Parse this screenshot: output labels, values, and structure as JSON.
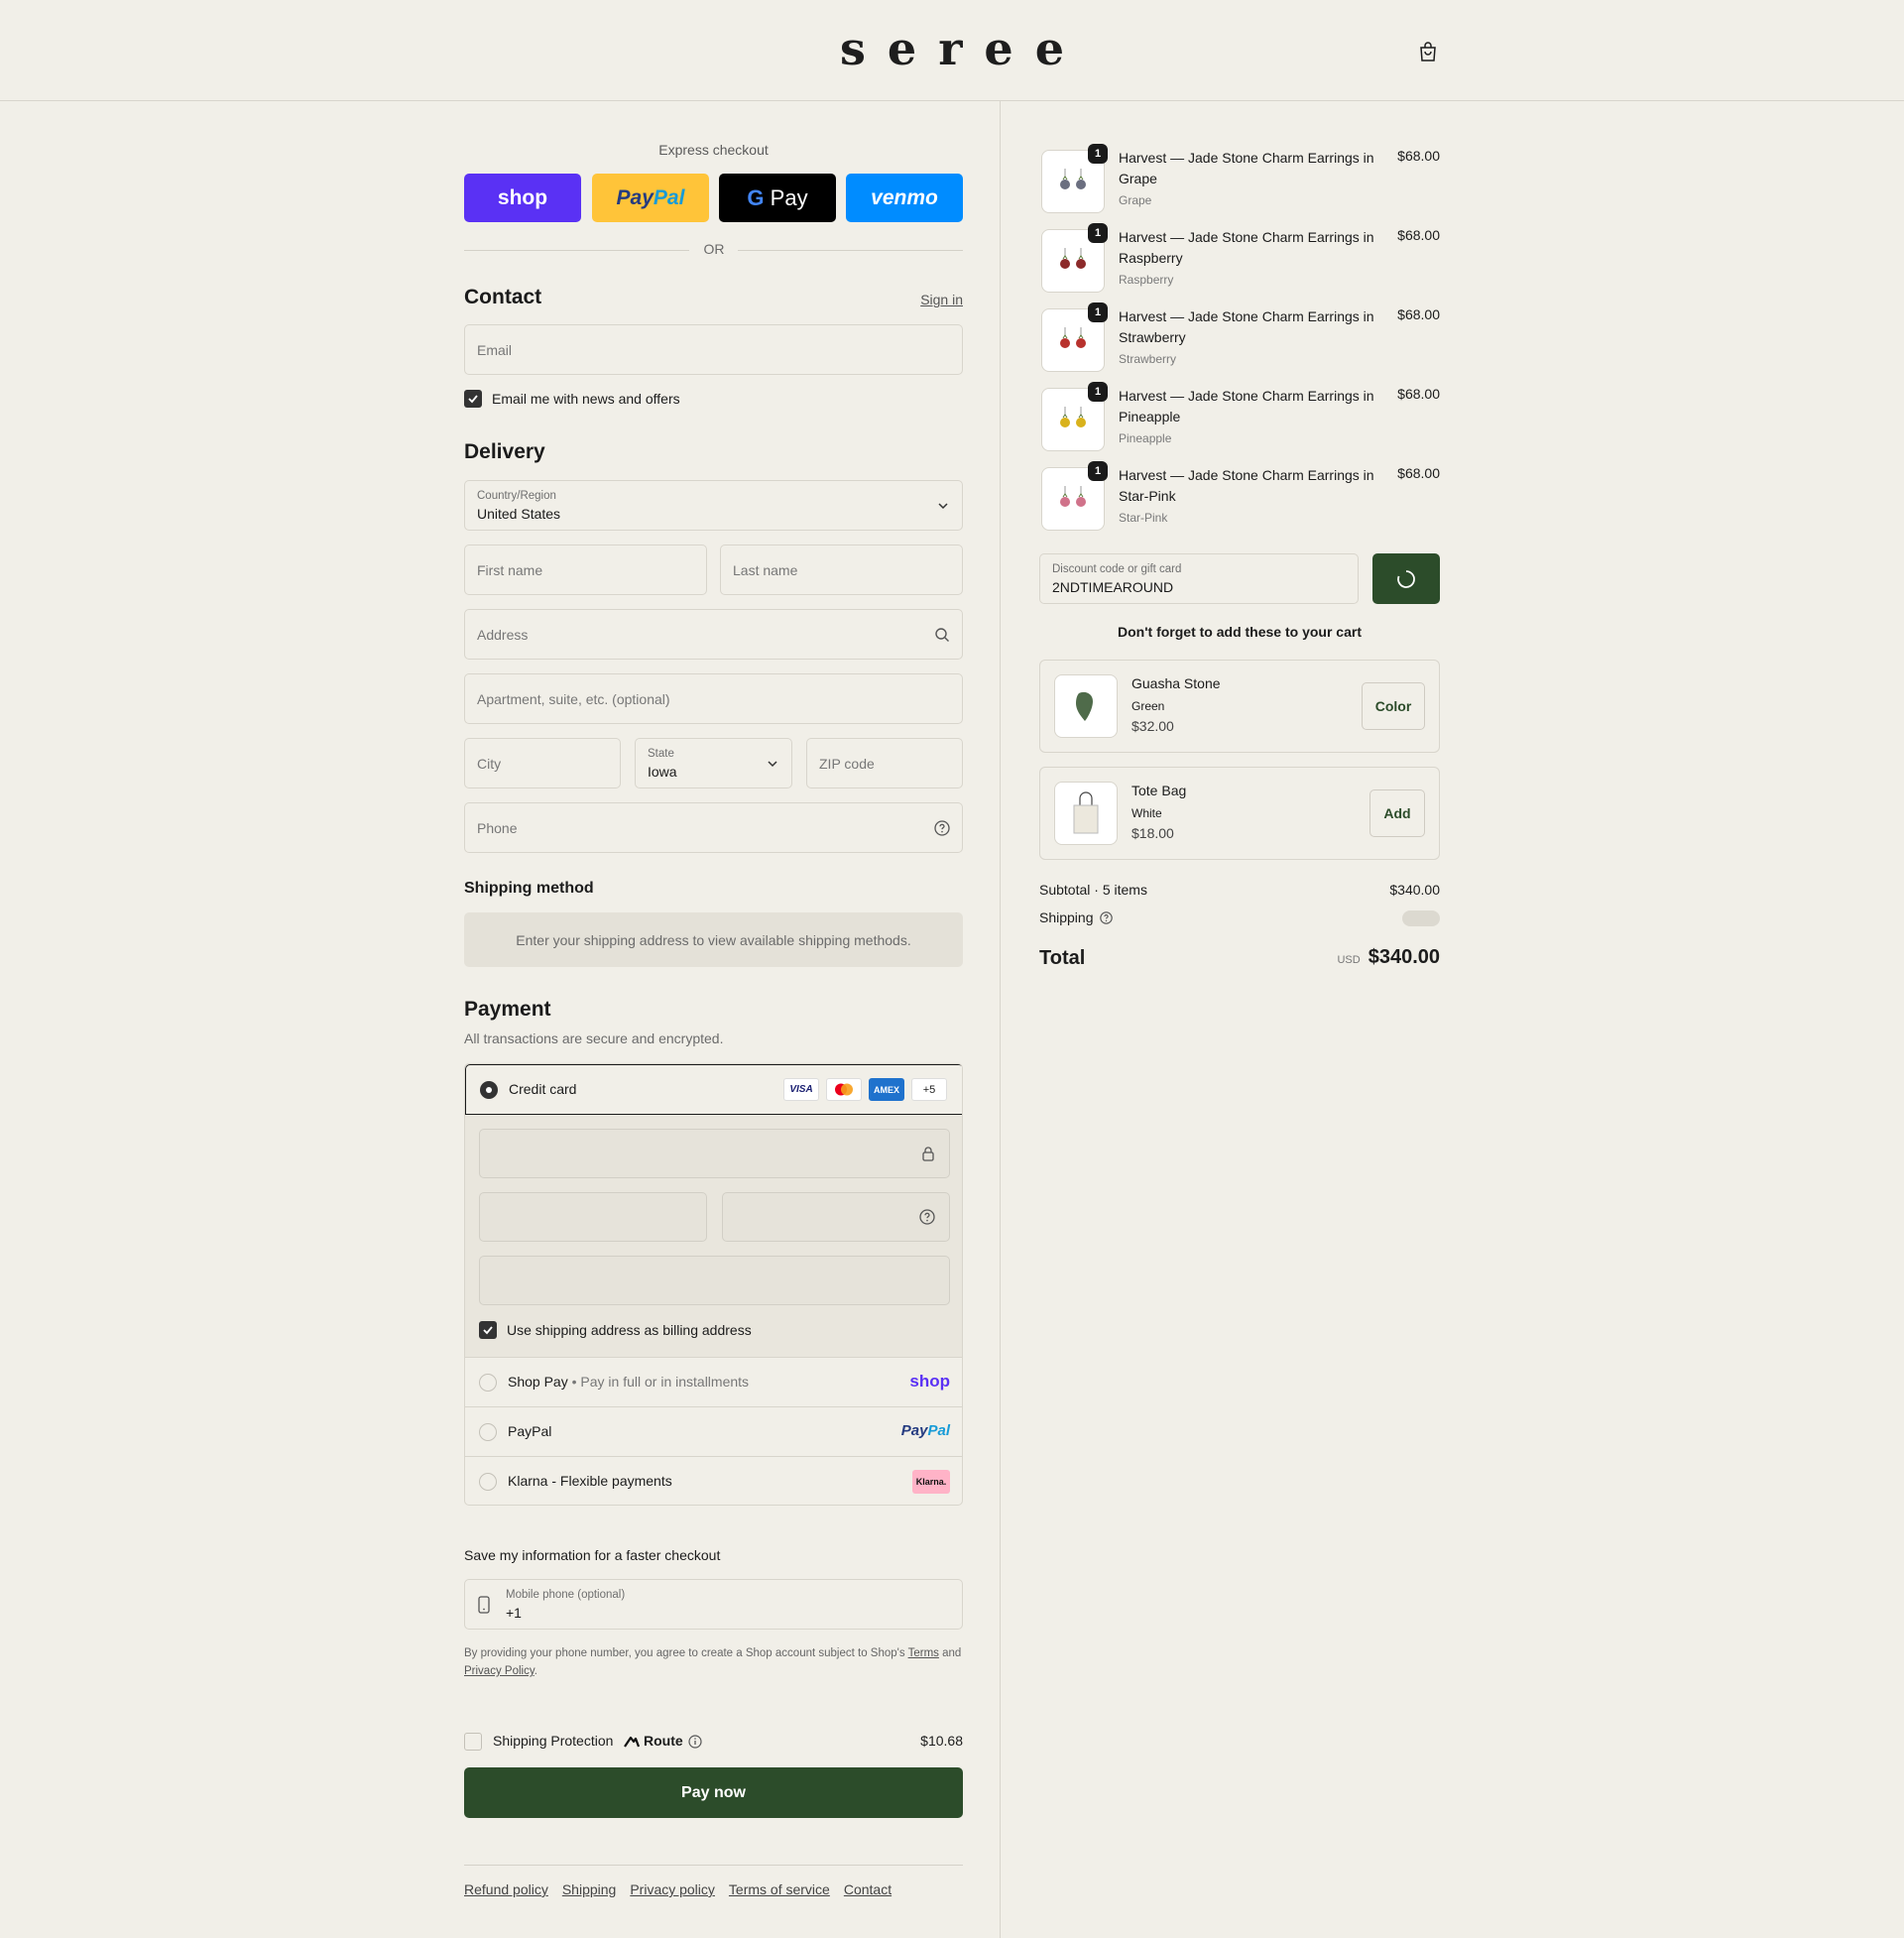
{
  "header": {
    "logo": "seree",
    "cart_icon": "shopping-bag-icon"
  },
  "express": {
    "label": "Express checkout",
    "buttons": [
      {
        "label": "shop",
        "color": "#5a31f4"
      },
      {
        "label": "PayPal",
        "color": "#ffc439"
      },
      {
        "label": "G Pay",
        "color": "#000000"
      },
      {
        "label": "venmo",
        "color": "#008cff"
      }
    ],
    "or": "OR"
  },
  "contact": {
    "title": "Contact",
    "sign_in": "Sign in",
    "email_placeholder": "Email",
    "newsletter": "Email me with news and offers",
    "newsletter_checked": true
  },
  "delivery": {
    "title": "Delivery",
    "country_label": "Country/Region",
    "country_value": "United States",
    "first_name": "First name",
    "last_name": "Last name",
    "address": "Address",
    "apartment": "Apartment, suite, etc. (optional)",
    "city": "City",
    "state_label": "State",
    "state_value": "Iowa",
    "zip": "ZIP code",
    "phone": "Phone"
  },
  "shipping_method": {
    "title": "Shipping method",
    "notice": "Enter your shipping address to view available shipping methods."
  },
  "payment": {
    "title": "Payment",
    "subtitle": "All transactions are secure and encrypted.",
    "credit_card": "Credit card",
    "card_logos": [
      "VISA",
      "Mastercard",
      "AMEX",
      "+5"
    ],
    "billing_same": "Use shipping address as billing address",
    "shop_pay": "Shop Pay",
    "shop_pay_sub": "Pay in full or in installments",
    "shop_pay_logo": "shop",
    "paypal": "PayPal",
    "paypal_logo": "PayPal",
    "klarna": "Klarna - Flexible payments",
    "klarna_logo": "Klarna."
  },
  "save_info": {
    "title": "Save my information for a faster checkout",
    "mobile_label": "Mobile phone (optional)",
    "mobile_value": "+1",
    "legal_1": "By providing your phone number, you agree to create a Shop account subject to Shop's",
    "terms": "Terms",
    "and": "and",
    "privacy": "Privacy Policy",
    "period": "."
  },
  "protection": {
    "label": "Shipping Protection",
    "brand": "Route",
    "price": "$10.68"
  },
  "pay_now": "Pay now",
  "footer_links": [
    "Refund policy",
    "Shipping",
    "Privacy policy",
    "Terms of service",
    "Contact"
  ],
  "cart": {
    "items": [
      {
        "title": "Harvest — Jade Stone Charm Earrings in Grape",
        "variant": "Grape",
        "price": "$68.00",
        "qty": "1",
        "color": "#6b6f80"
      },
      {
        "title": "Harvest — Jade Stone Charm Earrings in Raspberry",
        "variant": "Raspberry",
        "price": "$68.00",
        "qty": "1",
        "color": "#8c2a2a"
      },
      {
        "title": "Harvest — Jade Stone Charm Earrings in Strawberry",
        "variant": "Strawberry",
        "price": "$68.00",
        "qty": "1",
        "color": "#b8322d"
      },
      {
        "title": "Harvest — Jade Stone Charm Earrings in Pineapple",
        "variant": "Pineapple",
        "price": "$68.00",
        "qty": "1",
        "color": "#d9b21c"
      },
      {
        "title": "Harvest — Jade Stone Charm Earrings in Star-Pink",
        "variant": "Star-Pink",
        "price": "$68.00",
        "qty": "1",
        "color": "#d0728a"
      }
    ],
    "discount_label": "Discount code or gift card",
    "discount_value": "2NDTIMEAROUND",
    "upsell_title": "Don't forget to add these to your cart",
    "upsells": [
      {
        "name": "Guasha Stone",
        "variant": "Green",
        "price": "$32.00",
        "button": "Color"
      },
      {
        "name": "Tote Bag",
        "variant": "White",
        "price": "$18.00",
        "button": "Add"
      }
    ],
    "subtotal_label": "Subtotal · 5 items",
    "subtotal_value": "$340.00",
    "shipping_label": "Shipping",
    "total_label": "Total",
    "currency": "USD",
    "total_value": "$340.00"
  }
}
